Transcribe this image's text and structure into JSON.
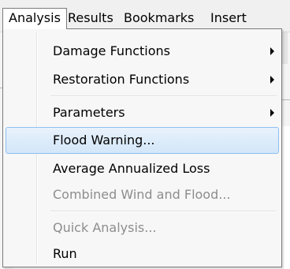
{
  "menubar": {
    "items": [
      "Analysis",
      "Results",
      "Bookmarks",
      "Insert"
    ]
  },
  "dropdown": {
    "items": [
      {
        "label": "Damage Functions",
        "submenu": true,
        "enabled": true
      },
      {
        "label": "Restoration Functions",
        "submenu": true,
        "enabled": true
      },
      {
        "label": "Parameters",
        "submenu": true,
        "enabled": true
      },
      {
        "label": "Flood Warning...",
        "submenu": false,
        "enabled": true,
        "highlighted": true
      },
      {
        "label": "Average Annualized Loss",
        "submenu": false,
        "enabled": true
      },
      {
        "label": "Combined Wind and Flood...",
        "submenu": false,
        "enabled": false
      },
      {
        "label": "Quick Analysis...",
        "submenu": false,
        "enabled": false
      },
      {
        "label": "Run",
        "submenu": false,
        "enabled": true
      }
    ]
  },
  "colors": {
    "highlight_border": "#8fbff0",
    "highlight_fill": "#d3e6f9",
    "disabled_text": "#8d8d8d"
  }
}
